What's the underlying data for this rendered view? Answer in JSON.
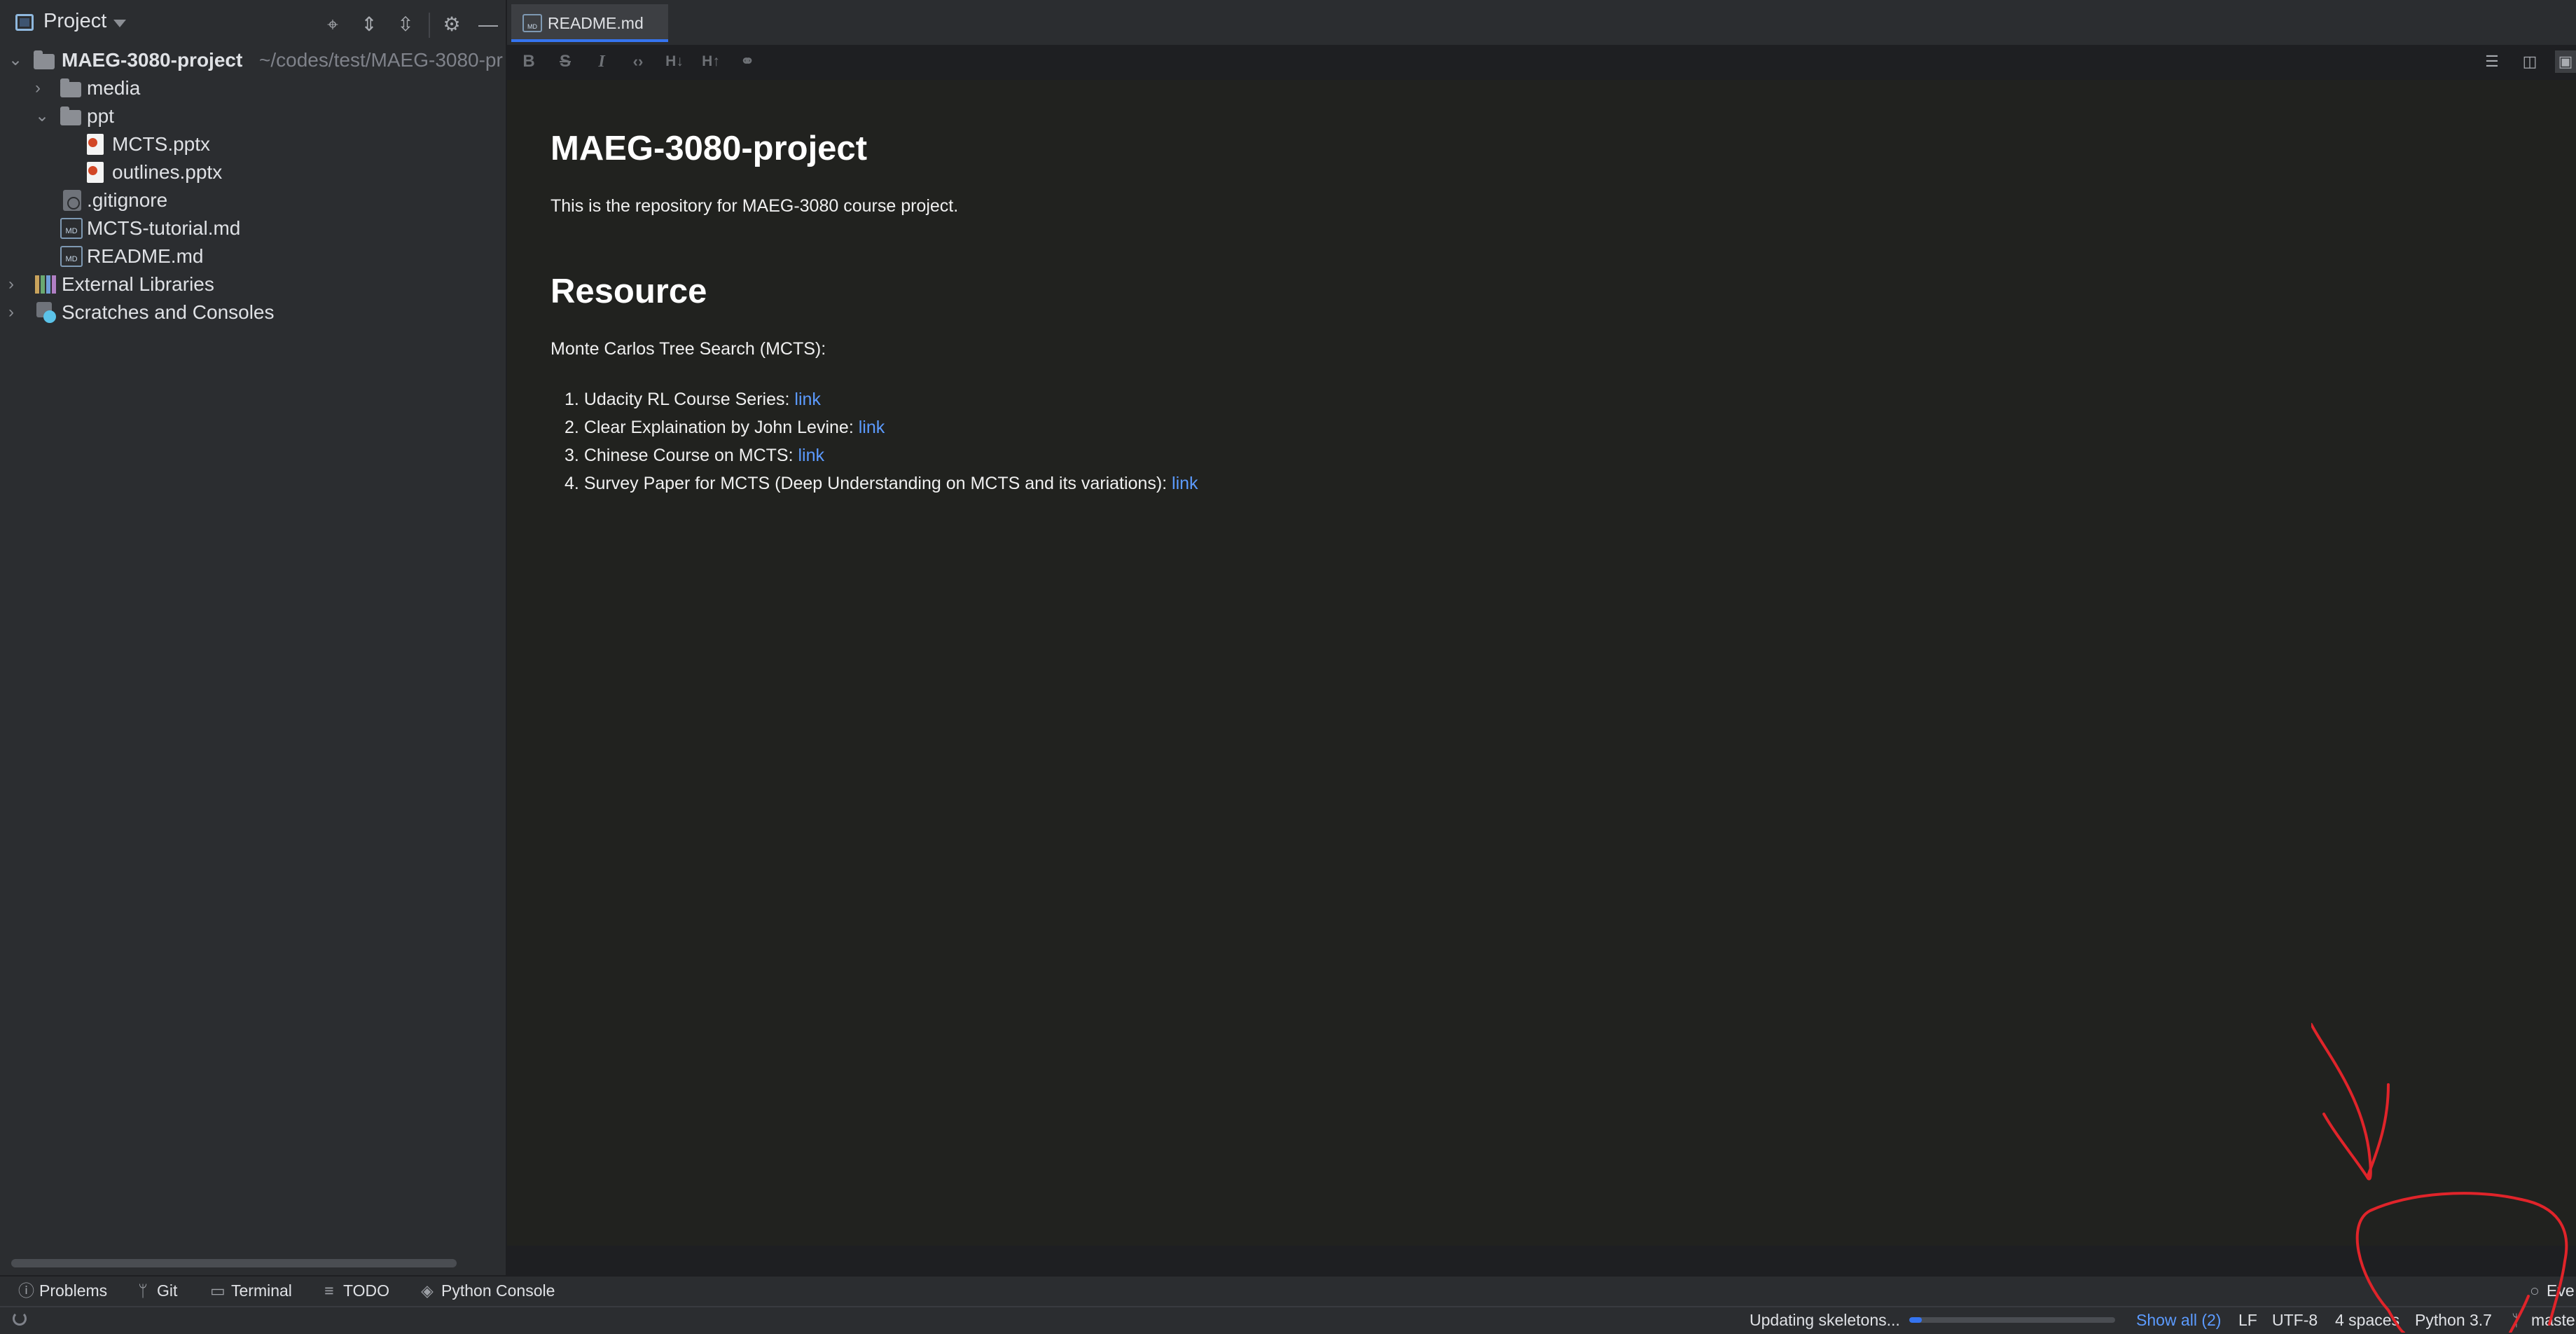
{
  "project_panel": {
    "title": "Project",
    "toolbar_icons": [
      "locate-icon",
      "expand-all-icon",
      "collapse-all-icon",
      "gear-icon",
      "minimize-icon"
    ],
    "tree": {
      "root_name": "MAEG-3080-project",
      "root_path": "~/codes/test/MAEG-3080-pr",
      "items": [
        {
          "label": "media",
          "type": "folder",
          "expanded": false
        },
        {
          "label": "ppt",
          "type": "folder",
          "expanded": true
        },
        {
          "label": "MCTS.pptx",
          "type": "pptx"
        },
        {
          "label": "outlines.pptx",
          "type": "pptx"
        },
        {
          "label": ".gitignore",
          "type": "gitignore"
        },
        {
          "label": "MCTS-tutorial.md",
          "type": "md"
        },
        {
          "label": "README.md",
          "type": "md"
        },
        {
          "label": "External Libraries",
          "type": "library"
        },
        {
          "label": "Scratches and Consoles",
          "type": "scratches"
        }
      ]
    }
  },
  "editor": {
    "active_tab": "README.md",
    "md_file_badge": "MD",
    "format_toolbar": [
      "B",
      "S",
      "I",
      "<>",
      "H↓",
      "H↑",
      "link-icon"
    ],
    "view_modes": [
      "editor-only-icon",
      "split-view-icon",
      "preview-only-icon"
    ],
    "preview": {
      "title": "MAEG-3080-project",
      "intro": "This is the repository for MAEG-3080 course project.",
      "section_heading": "Resource",
      "section_intro": "Monte Carlos Tree Search (MCTS):",
      "resources": [
        {
          "num": "1.",
          "text": "Udacity RL Course Series: ",
          "link": "link"
        },
        {
          "num": "2.",
          "text": "Clear Explaination by John Levine: ",
          "link": "link"
        },
        {
          "num": "3.",
          "text": "Chinese Course on MCTS: ",
          "link": "link"
        },
        {
          "num": "4.",
          "text": "Survey Paper for MCTS (Deep Understanding on MCTS and its variations): ",
          "link": "link"
        }
      ]
    }
  },
  "tool_windows": {
    "problems": "Problems",
    "git": "Git",
    "terminal": "Terminal",
    "todo": "TODO",
    "python_console": "Python Console",
    "event_log": "Eve"
  },
  "status_bar": {
    "task": "Updating skeletons...",
    "progress": 0.06,
    "show_all": "Show all (2)",
    "line_separator": "LF",
    "encoding": "UTF-8",
    "indent": "4 spaces",
    "interpreter": "Python 3.7",
    "branch": "maste"
  },
  "colors": {
    "accent": "#3574f0",
    "link": "#5c9bff",
    "annotation_ink": "#e0242a"
  }
}
